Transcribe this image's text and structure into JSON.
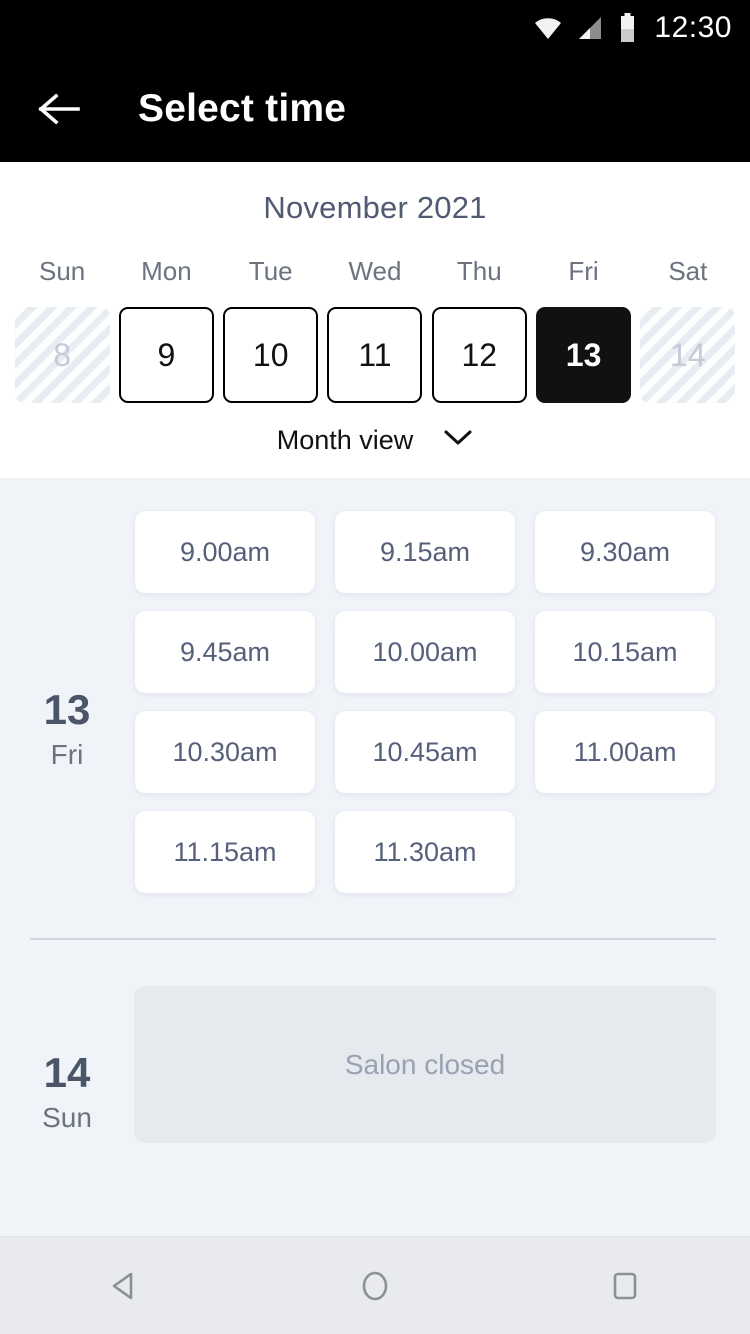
{
  "statusbar": {
    "time": "12:30",
    "icons": [
      "wifi-icon",
      "cell-signal-icon",
      "battery-icon"
    ]
  },
  "appbar": {
    "back_icon": "back-arrow-icon",
    "title": "Select time"
  },
  "calendar": {
    "month_label": "November 2021",
    "weekday_headers": [
      "Sun",
      "Mon",
      "Tue",
      "Wed",
      "Thu",
      "Fri",
      "Sat"
    ],
    "days": [
      {
        "number": "8",
        "state": "disabled"
      },
      {
        "number": "9",
        "state": "available"
      },
      {
        "number": "10",
        "state": "available"
      },
      {
        "number": "11",
        "state": "available"
      },
      {
        "number": "12",
        "state": "available"
      },
      {
        "number": "13",
        "state": "selected"
      },
      {
        "number": "14",
        "state": "disabled"
      }
    ],
    "view_toggle": {
      "label": "Month view",
      "icon": "chevron-down-icon"
    }
  },
  "schedule": [
    {
      "day_number": "13",
      "weekday": "Fri",
      "slots": [
        "9.00am",
        "9.15am",
        "9.30am",
        "9.45am",
        "10.00am",
        "10.15am",
        "10.30am",
        "10.45am",
        "11.00am",
        "11.15am",
        "11.30am"
      ]
    },
    {
      "day_number": "14",
      "weekday": "Sun",
      "closed_message": "Salon closed"
    }
  ],
  "navbar": {
    "back_label": "back-nav-icon",
    "home_label": "home-nav-icon",
    "recents_label": "recents-nav-icon"
  },
  "colors": {
    "appbar_bg": "#000000",
    "content_bg": "#f0f3f8",
    "accent_selected": "#111111",
    "slate_text": "#515a72",
    "muted_text": "#98a2b3"
  }
}
